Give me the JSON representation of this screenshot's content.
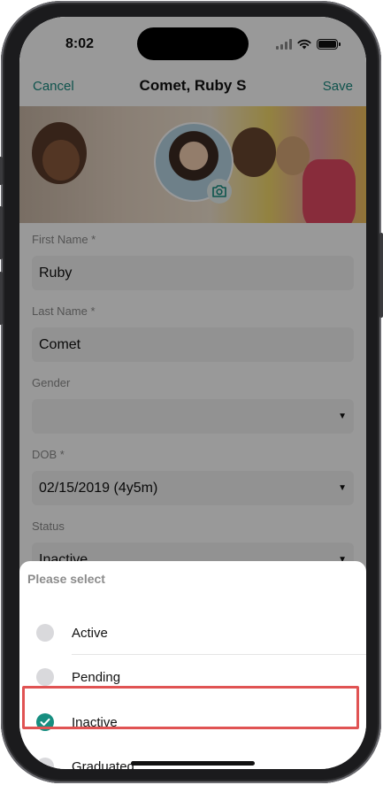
{
  "status_bar": {
    "time": "8:02"
  },
  "nav": {
    "cancel_label": "Cancel",
    "title": "Comet, Ruby S",
    "save_label": "Save"
  },
  "form": {
    "first_name": {
      "label": "First Name *",
      "value": "Ruby"
    },
    "last_name": {
      "label": "Last Name *",
      "value": "Comet"
    },
    "gender": {
      "label": "Gender",
      "value": ""
    },
    "dob": {
      "label": "DOB *",
      "value": "02/15/2019 (4y5m)"
    },
    "status": {
      "label": "Status",
      "value": "Inactive"
    }
  },
  "sheet": {
    "title": "Please select",
    "options": [
      {
        "label": "Active",
        "selected": false
      },
      {
        "label": "Pending",
        "selected": false
      },
      {
        "label": "Inactive",
        "selected": true
      },
      {
        "label": "Graduated",
        "selected": false
      }
    ]
  },
  "colors": {
    "accent": "#168e80",
    "link": "#1a8a80",
    "highlight": "#e05353"
  },
  "icons": {
    "camera": "camera-icon",
    "dropdown": "caret-down-icon",
    "check": "checkmark-icon"
  }
}
